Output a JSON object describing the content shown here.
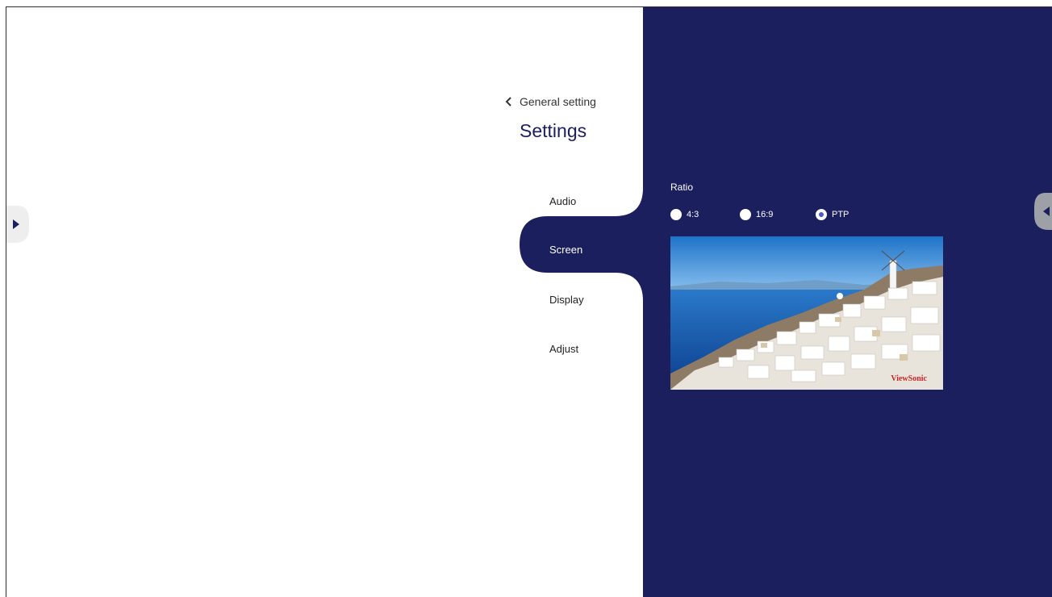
{
  "header": {
    "back_label": "General setting",
    "title": "Settings"
  },
  "nav": {
    "items": [
      {
        "label": "Audio",
        "active": false
      },
      {
        "label": "Screen",
        "active": true
      },
      {
        "label": "Display",
        "active": false
      },
      {
        "label": "Adjust",
        "active": false
      }
    ]
  },
  "screen": {
    "ratio_label": "Ratio",
    "options": [
      {
        "label": "4:3",
        "selected": false
      },
      {
        "label": "16:9",
        "selected": false
      },
      {
        "label": "PTP",
        "selected": true
      }
    ],
    "preview_watermark": "ViewSonic"
  },
  "icons": {
    "back": "chevron-left-icon",
    "left_handle": "play-right-icon",
    "right_handle": "play-left-icon"
  },
  "colors": {
    "panel": "#1b1f5e",
    "accent": "#4f56c8",
    "text_dark": "#333333"
  }
}
